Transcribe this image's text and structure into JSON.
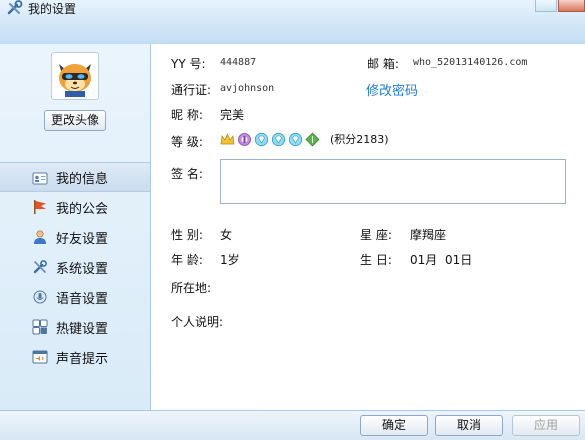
{
  "window": {
    "title": "我的设置"
  },
  "sidebar": {
    "change_avatar": "更改头像",
    "items": [
      {
        "label": "我的信息",
        "icon": "id-card-icon",
        "active": true
      },
      {
        "label": "我的公会",
        "icon": "flag-icon"
      },
      {
        "label": "好友设置",
        "icon": "user-icon"
      },
      {
        "label": "系统设置",
        "icon": "tools-icon"
      },
      {
        "label": "语音设置",
        "icon": "voice-icon"
      },
      {
        "label": "热键设置",
        "icon": "keyboard-icon"
      },
      {
        "label": "声音提示",
        "icon": "sound-icon"
      }
    ]
  },
  "profile": {
    "yy_label": "YY 号:",
    "yy_value": "444887",
    "email_label": "邮 箱:",
    "email_value": "who_52013140126.com",
    "passport_label": "通行证:",
    "passport_value": "avjohnson",
    "change_password": "修改密码",
    "nickname_label": "昵 称:",
    "nickname_value": "完美",
    "level_label": "等 级:",
    "points_text": "(积分2183)",
    "signature_label": "签 名:",
    "gender_label": "性 别:",
    "gender_value": "女",
    "zodiac_label": "星 座:",
    "zodiac_value": "摩羯座",
    "age_label": "年 龄:",
    "age_value": "1岁",
    "birthday_label": "生 日:",
    "birthday_month": "01月",
    "birthday_day": "01日",
    "location_label": "所在地:",
    "bio_label": "个人说明:"
  },
  "footer": {
    "ok": "确定",
    "cancel": "取消",
    "apply": "应用"
  },
  "colors": {
    "link": "#1f7ed8",
    "panel": "#d9ebf8"
  }
}
